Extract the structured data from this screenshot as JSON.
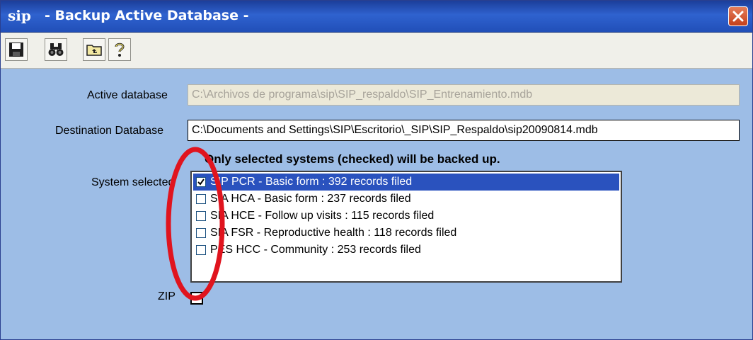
{
  "window": {
    "logo_text": "sip",
    "title": "- Backup Active Database -"
  },
  "toolbar": {
    "buttons": [
      {
        "name": "save-icon"
      },
      {
        "name": "binoculars-icon"
      },
      {
        "name": "folder-up-icon"
      },
      {
        "name": "help-icon"
      }
    ]
  },
  "form": {
    "active_db_label": "Active database",
    "active_db_value": "C:\\Archivos de programa\\sip\\SIP_respaldo\\SIP_Entrenamiento.mdb",
    "dest_db_label": "Destination Database",
    "dest_db_value": "C:\\Documents and Settings\\SIP\\Escritorio\\_SIP\\SIP_Respaldo\\sip20090814.mdb",
    "notice": "Only selected systems (checked) will be backed up.",
    "system_label": "System selected",
    "systems": [
      {
        "label": "SIP PCR - Basic form : 392 records filed",
        "checked": true,
        "selected": true
      },
      {
        "label": "SIA HCA - Basic form : 237 records filed",
        "checked": false,
        "selected": false
      },
      {
        "label": "SIA HCE - Follow up visits : 115 records filed",
        "checked": false,
        "selected": false
      },
      {
        "label": "SIA FSR - Reproductive health : 118 records filed",
        "checked": false,
        "selected": false
      },
      {
        "label": "PES HCC - Community : 253 records filed",
        "checked": false,
        "selected": false
      }
    ],
    "zip_label": "ZIP",
    "zip_checked": false
  },
  "colors": {
    "window_bg": "#9dbde6",
    "titlebar": "#2f62cf",
    "selection": "#2a52be",
    "annotation": "#e0141e"
  }
}
